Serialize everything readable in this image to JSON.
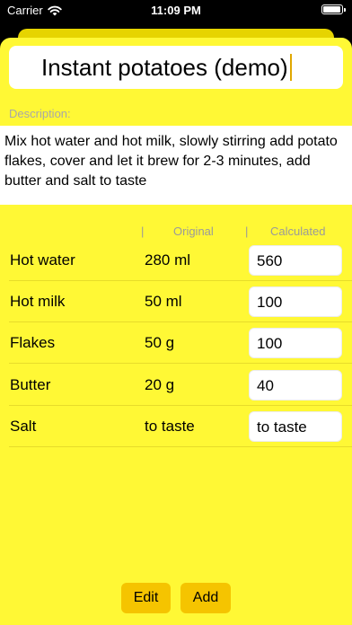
{
  "status_bar": {
    "carrier": "Carrier",
    "time": "11:09 PM"
  },
  "recipe": {
    "title": "Instant potatoes (demo)",
    "description_label": "Description:",
    "description": "Mix hot water and hot milk, slowly stirring add potato flakes, cover and let it brew for 2-3 minutes, add butter and salt to taste"
  },
  "table": {
    "separator": "|",
    "headers": {
      "original": "Original",
      "calculated": "Calculated"
    },
    "rows": [
      {
        "name": "Hot water",
        "original": "280 ml",
        "calculated": "560"
      },
      {
        "name": "Hot milk",
        "original": "50 ml",
        "calculated": "100"
      },
      {
        "name": "Flakes",
        "original": "50 g",
        "calculated": "100"
      },
      {
        "name": "Butter",
        "original": "20 g",
        "calculated": "40"
      },
      {
        "name": "Salt",
        "original": "to taste",
        "calculated": "to taste"
      }
    ]
  },
  "buttons": {
    "edit": "Edit",
    "add": "Add"
  },
  "colors": {
    "sheet_background": "#fff835",
    "button": "#f5c400",
    "caret": "#e0a800"
  }
}
